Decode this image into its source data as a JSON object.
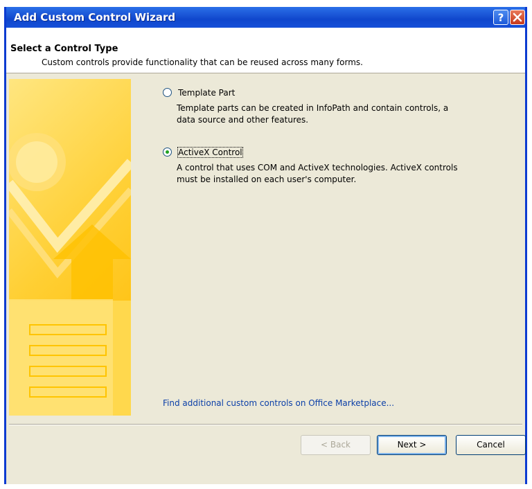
{
  "window": {
    "title": "Add Custom Control Wizard",
    "help_glyph": "?",
    "close_glyph": "✕"
  },
  "header": {
    "title": "Select a Control Type",
    "subtitle": "Custom controls provide functionality that can be reused across many forms."
  },
  "options": [
    {
      "label": "Template Part",
      "selected": false,
      "description": "Template parts can be created in InfoPath and contain controls, a\ndata source and other features."
    },
    {
      "label": "ActiveX Control",
      "selected": true,
      "description": "A control that uses COM and ActiveX technologies. ActiveX controls\nmust be installed on each user's computer."
    }
  ],
  "link": {
    "marketplace": "Find additional custom controls on Office Marketplace..."
  },
  "buttons": {
    "back": "< Back",
    "next": "Next >",
    "cancel": "Cancel"
  },
  "colors": {
    "title_bar": "#1a55d6",
    "dialog_bg": "#ece9d8",
    "link": "#0b3fa8",
    "graphic_yellow": "#ffcf33"
  }
}
